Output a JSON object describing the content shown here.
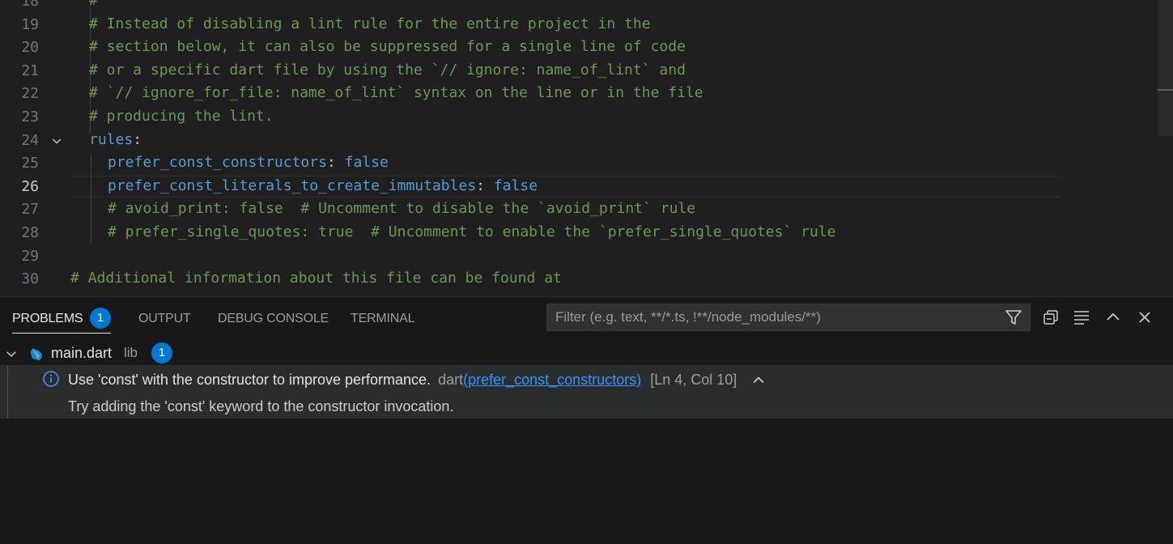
{
  "editor": {
    "lines": [
      {
        "num": "18",
        "parts": [
          {
            "t": "#",
            "c": "comment"
          }
        ],
        "indent": 1
      },
      {
        "num": "19",
        "parts": [
          {
            "t": "# Instead of disabling a lint rule for the entire project in the",
            "c": "comment"
          }
        ],
        "indent": 1
      },
      {
        "num": "20",
        "parts": [
          {
            "t": "# section below, it can also be suppressed for a single line of code",
            "c": "comment"
          }
        ],
        "indent": 1
      },
      {
        "num": "21",
        "parts": [
          {
            "t": "# or a specific dart file by using the `// ignore: name_of_lint` and",
            "c": "comment"
          }
        ],
        "indent": 1
      },
      {
        "num": "22",
        "parts": [
          {
            "t": "# `// ignore_for_file: name_of_lint` syntax on the line or in the file",
            "c": "comment"
          }
        ],
        "indent": 1
      },
      {
        "num": "23",
        "parts": [
          {
            "t": "# producing the lint.",
            "c": "comment"
          }
        ],
        "indent": 1
      },
      {
        "num": "24",
        "parts": [
          {
            "t": "rules",
            "c": "key"
          },
          {
            "t": ":",
            "c": "plain"
          }
        ],
        "indent": 1,
        "fold": true
      },
      {
        "num": "25",
        "parts": [
          {
            "t": "prefer_const_constructors",
            "c": "key"
          },
          {
            "t": ": ",
            "c": "plain"
          },
          {
            "t": "false",
            "c": "val"
          }
        ],
        "indent": 2
      },
      {
        "num": "26",
        "parts": [
          {
            "t": "prefer_const_literals_to_create_immutables",
            "c": "key"
          },
          {
            "t": ": ",
            "c": "plain"
          },
          {
            "t": "false",
            "c": "val"
          }
        ],
        "indent": 2,
        "active": true
      },
      {
        "num": "27",
        "parts": [
          {
            "t": "# avoid_print: false  # Uncomment to disable the `avoid_print` rule",
            "c": "comment"
          }
        ],
        "indent": 2
      },
      {
        "num": "28",
        "parts": [
          {
            "t": "# prefer_single_quotes: true  # Uncomment to enable the `prefer_single_quotes` rule",
            "c": "comment"
          }
        ],
        "indent": 2
      },
      {
        "num": "29",
        "parts": [],
        "indent": 0
      },
      {
        "num": "30",
        "parts": [
          {
            "t": "# Additional information about this file can be found at",
            "c": "comment"
          }
        ],
        "indent": 0
      }
    ]
  },
  "panel": {
    "tabs": [
      {
        "label": "PROBLEMS",
        "active": true
      },
      {
        "label": "OUTPUT"
      },
      {
        "label": "DEBUG CONSOLE"
      },
      {
        "label": "TERMINAL"
      }
    ],
    "problems_count": "1",
    "filter_placeholder": "Filter (e.g. text, **/*.ts, !**/node_modules/**)",
    "file": {
      "name": "main.dart",
      "dir": "lib",
      "count": "1"
    },
    "problem": {
      "message": "Use 'const' with the constructor to improve performance.",
      "source": "dart",
      "code": "prefer_const_constructors",
      "position": "[Ln 4, Col 10]",
      "detail": "Try adding the 'const' keyword to the constructor invocation."
    }
  },
  "colors": {
    "accent": "#0078d4",
    "comment": "#6a9955",
    "keyword": "#569cd6",
    "link": "#3794ff"
  }
}
